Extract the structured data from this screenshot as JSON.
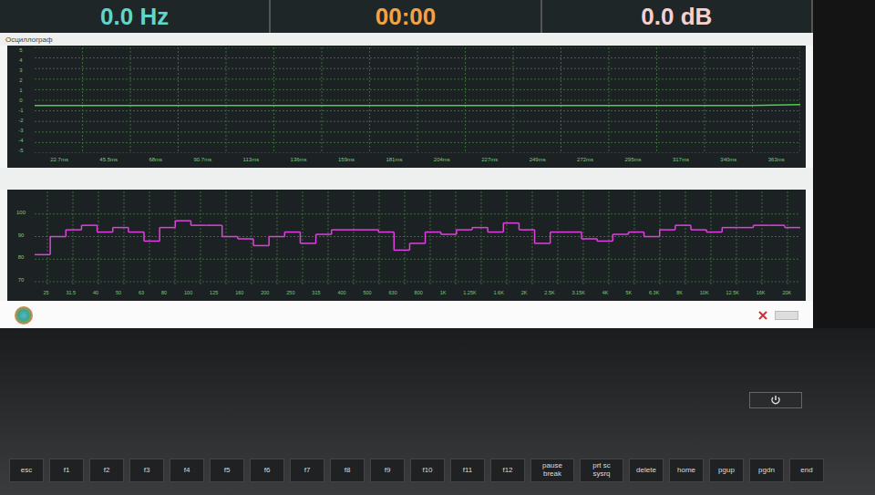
{
  "readouts": [
    {
      "label": "0.0 Hz",
      "color": "#5fd6cc"
    },
    {
      "label": "00:00",
      "color": "#f2a444"
    },
    {
      "label": "0.0 dB",
      "color": "#f5d0cc"
    }
  ],
  "scope": {
    "title": "Осциллограф",
    "y_ticks": [
      "5",
      "4",
      "3",
      "2",
      "1",
      "0",
      "-1",
      "-2",
      "-3",
      "-4",
      "-5"
    ],
    "x_ticks": [
      "22.7ms",
      "45.5ms",
      "68ms",
      "90.7ms",
      "113ms",
      "136ms",
      "159ms",
      "181ms",
      "204ms",
      "227ms",
      "249ms",
      "272ms",
      "295ms",
      "317ms",
      "340ms",
      "363ms"
    ],
    "values": [
      -0.5,
      -0.5,
      -0.5,
      -0.5,
      -0.5,
      -0.5,
      -0.5,
      -0.5,
      -0.5,
      -0.5,
      -0.5,
      -0.5,
      -0.5,
      -0.5,
      -0.5,
      -0.4
    ]
  },
  "spectrum": {
    "y_ticks": [
      "100",
      "90",
      "80",
      "70"
    ],
    "x_ticks": [
      "25",
      "31.5",
      "40",
      "50",
      "63",
      "80",
      "100",
      "125",
      "160",
      "200",
      "250",
      "315",
      "400",
      "500",
      "630",
      "800",
      "1K",
      "1.25K",
      "1.6K",
      "2K",
      "2.5K",
      "3.15K",
      "4K",
      "5K",
      "6.3K",
      "8K",
      "10K",
      "12.5K",
      "16K",
      "20K"
    ],
    "values": [
      82,
      90,
      93,
      95,
      92,
      94,
      92,
      88,
      94,
      97,
      95,
      95,
      90,
      89,
      86,
      90,
      92,
      87,
      91,
      93,
      93,
      93,
      92,
      84,
      87,
      92,
      91,
      93,
      94,
      92,
      96,
      93,
      87,
      92,
      92,
      89,
      88,
      91,
      92,
      90,
      93,
      95,
      93,
      92,
      94,
      94,
      95,
      95,
      94
    ]
  },
  "keys": [
    "esc",
    "f1",
    "f2",
    "f3",
    "f4",
    "f5",
    "f6",
    "f7",
    "f8",
    "f9",
    "f10",
    "f11",
    "f12",
    "pause break",
    "prt sc sysrq",
    "delete",
    "home",
    "pgup",
    "pgdn",
    "end"
  ]
}
